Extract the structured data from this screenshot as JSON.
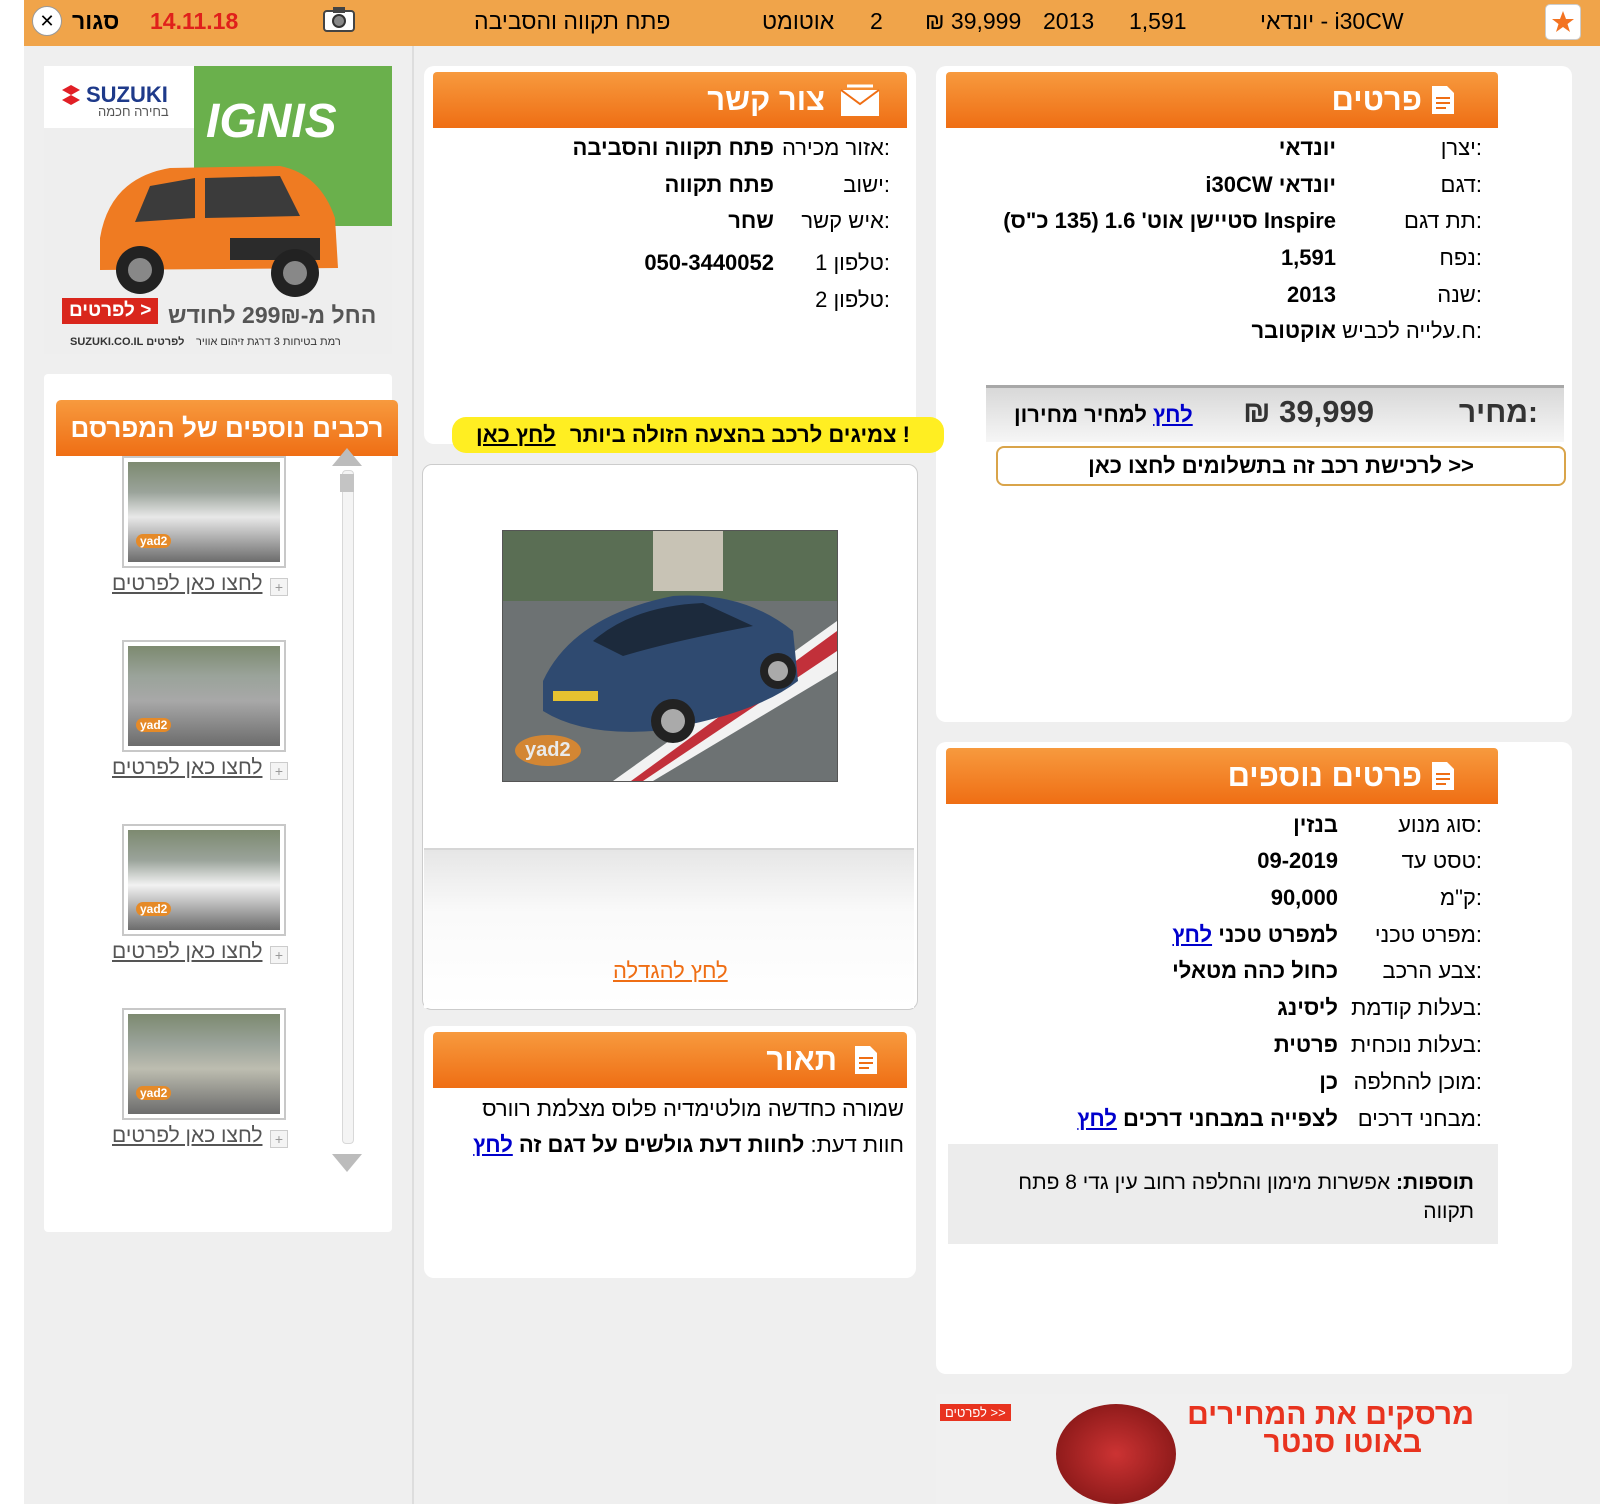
{
  "topbar": {
    "close_label": "סגור",
    "date": "14.11.18",
    "area": "פתח תקווה והסביבה",
    "gear": "אוטומט",
    "hand": "2",
    "price": "₪ 39,999",
    "year": "2013",
    "engine": "1,591",
    "model": "יונדאי - i30CW"
  },
  "details": {
    "title": "פרטים",
    "rows": [
      {
        "label": "יצרן:",
        "value": "יונדאי"
      },
      {
        "label": "דגם:",
        "value": "יונדאי i30CW"
      },
      {
        "label": "תת דגם:",
        "value": "Inspire סטיישן אוט' 1.6 (135 כ\"ס)"
      },
      {
        "label": "נפח:",
        "value": "1,591"
      },
      {
        "label": "שנה:",
        "value": "2013"
      },
      {
        "label": "ח.עלייה לכביש:",
        "value": "אוקטובר"
      }
    ],
    "price_label": "מחיר:",
    "price_value": "₪ 39,999",
    "pricelist_text": "למחיר מחירון",
    "pricelist_link": "לחץ",
    "buy_button": "לרכישת רכב זה בתשלומים לחצו כאן >>"
  },
  "contact": {
    "title": "צור קשר",
    "rows": [
      {
        "label": "אזור מכירה:",
        "value": "פתח תקווה והסביבה"
      },
      {
        "label": "ישוב:",
        "value": "פתח תקווה"
      },
      {
        "label": "איש קשר:",
        "value": "שחר"
      },
      {
        "label": "טלפון 1:",
        "value": "050-3440052"
      },
      {
        "label": "טלפון 2:",
        "value": ""
      }
    ],
    "promo_text": "צמיגים לרכב בהצעה הזולה ביותר !",
    "promo_link": "לחץ כאן"
  },
  "photo": {
    "enlarge_link": "לחץ להגדלה",
    "watermark": "yad2"
  },
  "description": {
    "title": "תאור",
    "text": "שמורה כחדשה מולטימדיה פלוס מצלמת רוורס",
    "opinion_label": "חוות דעת:",
    "opinion_text": "לחוות דעת גולשים על דגם זה",
    "opinion_link": "לחץ"
  },
  "more_details": {
    "title": "פרטים נוספים",
    "rows": [
      {
        "label": "סוג מנוע:",
        "value": "בנזין"
      },
      {
        "label": "טסט עד:",
        "value": "09-2019"
      },
      {
        "label": "ק\"מ:",
        "value": "90,000"
      },
      {
        "label": "מפרט טכני:",
        "value": "למפרט טכני",
        "link": "לחץ"
      },
      {
        "label": "צבע הרכב:",
        "value": "כחול כהה מטאלי"
      },
      {
        "label": "בעלות קודמת:",
        "value": "ליסינג"
      },
      {
        "label": "בעלות נוכחית:",
        "value": "פרטית"
      },
      {
        "label": "מוכן להחלפה:",
        "value": "כן"
      },
      {
        "label": "מבחני דרכים:",
        "value": "לצפייה במבחני דרכים",
        "link": "לחץ"
      }
    ],
    "extras_label": "תוספות:",
    "extras_text": "אפשרות מימון והחלפה רחוב עין גדי 8 פתח תקווה"
  },
  "ad": {
    "brand": "SUZUKI",
    "brand_sub": "בחירה חכמה",
    "model": "IGNIS",
    "offer": "החל מ-299₪ לחודש",
    "cta": "לפרטים >",
    "footer": "SUZUKI.CO.IL לפרטים",
    "footer_left": "רמת בטיחות 3 דרגת זיהום אוויר"
  },
  "sidebar": {
    "title": "רכבים נוספים של המפרסם",
    "items": [
      {
        "link": "לחצו כאן לפרטים",
        "color": "#e8e8e8"
      },
      {
        "link": "לחצו כאן לפרטים",
        "color": "#a8a8a8"
      },
      {
        "link": "לחצו כאן לפרטים",
        "color": "#f2f2f2"
      },
      {
        "link": "לחצו כאן לפרטים",
        "color": "#bdbdb0"
      }
    ]
  },
  "bottom_ad": {
    "line1": "מרסקים את המחירים",
    "line2": "באוטו סנטר",
    "cta": "לפרטים >>"
  },
  "colors": {
    "orange": "#ef6e14",
    "topbar": "#f0a44a",
    "link": "#0000cc",
    "date_red": "#e0201b"
  }
}
